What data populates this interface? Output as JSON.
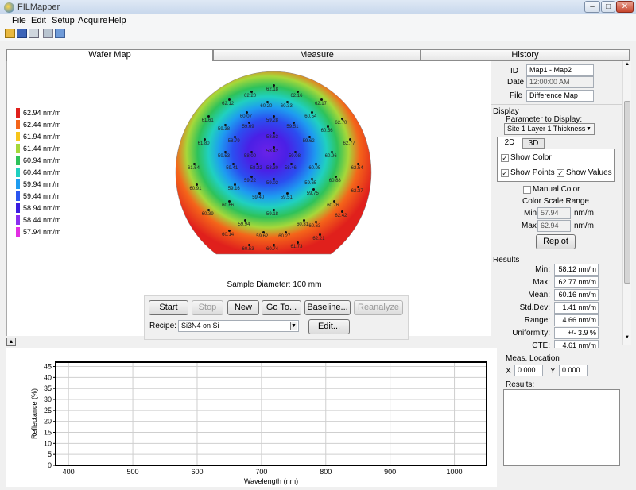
{
  "window": {
    "title": "FILMapper",
    "min": "–",
    "max": "□",
    "close": "✕"
  },
  "menu": [
    "File",
    "Edit",
    "Setup",
    "Acquire",
    "Help"
  ],
  "tabs": [
    "Wafer Map",
    "Measure",
    "History"
  ],
  "legend": [
    {
      "label": "62.94 nm/m",
      "color": "#e0201c"
    },
    {
      "label": "62.44 nm/m",
      "color": "#f4651a"
    },
    {
      "label": "61.94 nm/m",
      "color": "#f7c51b"
    },
    {
      "label": "61.44 nm/m",
      "color": "#a6d83a"
    },
    {
      "label": "60.94 nm/m",
      "color": "#2ec25a"
    },
    {
      "label": "60.44 nm/m",
      "color": "#20d0c0"
    },
    {
      "label": "59.94 nm/m",
      "color": "#1e9cf0"
    },
    {
      "label": "59.44 nm/m",
      "color": "#2b56f0"
    },
    {
      "label": "58.94 nm/m",
      "color": "#3b1ee0"
    },
    {
      "label": "58.44 nm/m",
      "color": "#8a2ef0"
    },
    {
      "label": "57.94 nm/m",
      "color": "#e22ee2"
    }
  ],
  "wafer": {
    "sample_diameter": "Sample Diameter: 100 mm",
    "points": [
      {
        "v": "62.18",
        "x": 0.5,
        "y": 0.1
      },
      {
        "v": "62.20",
        "x": 0.39,
        "y": 0.13
      },
      {
        "v": "62.16",
        "x": 0.62,
        "y": 0.13
      },
      {
        "v": "62.12",
        "x": 0.28,
        "y": 0.17
      },
      {
        "v": "60.20",
        "x": 0.47,
        "y": 0.18
      },
      {
        "v": "60.33",
        "x": 0.57,
        "y": 0.18
      },
      {
        "v": "62.17",
        "x": 0.74,
        "y": 0.17
      },
      {
        "v": "60.07",
        "x": 0.37,
        "y": 0.23
      },
      {
        "v": "60.54",
        "x": 0.69,
        "y": 0.23
      },
      {
        "v": "61.61",
        "x": 0.18,
        "y": 0.25
      },
      {
        "v": "62.70",
        "x": 0.84,
        "y": 0.26
      },
      {
        "v": "59.28",
        "x": 0.5,
        "y": 0.25
      },
      {
        "v": "59.38",
        "x": 0.26,
        "y": 0.29
      },
      {
        "v": "59.69",
        "x": 0.38,
        "y": 0.28
      },
      {
        "v": "59.51",
        "x": 0.6,
        "y": 0.28
      },
      {
        "v": "60.56",
        "x": 0.77,
        "y": 0.3
      },
      {
        "v": "58.63",
        "x": 0.5,
        "y": 0.33
      },
      {
        "v": "58.79",
        "x": 0.31,
        "y": 0.35
      },
      {
        "v": "59.62",
        "x": 0.68,
        "y": 0.35
      },
      {
        "v": "61.80",
        "x": 0.16,
        "y": 0.36
      },
      {
        "v": "62.77",
        "x": 0.88,
        "y": 0.36
      },
      {
        "v": "58.42",
        "x": 0.5,
        "y": 0.4
      },
      {
        "v": "59.53",
        "x": 0.26,
        "y": 0.42
      },
      {
        "v": "58.00",
        "x": 0.39,
        "y": 0.42
      },
      {
        "v": "59.08",
        "x": 0.61,
        "y": 0.42
      },
      {
        "v": "60.96",
        "x": 0.79,
        "y": 0.42
      },
      {
        "v": "61.54",
        "x": 0.11,
        "y": 0.48
      },
      {
        "v": "59.41",
        "x": 0.3,
        "y": 0.48
      },
      {
        "v": "58.22",
        "x": 0.42,
        "y": 0.48
      },
      {
        "v": "58.30",
        "x": 0.5,
        "y": 0.48
      },
      {
        "v": "58.46",
        "x": 0.59,
        "y": 0.48
      },
      {
        "v": "60.05",
        "x": 0.71,
        "y": 0.48
      },
      {
        "v": "62.54",
        "x": 0.92,
        "y": 0.48
      },
      {
        "v": "59.22",
        "x": 0.39,
        "y": 0.54
      },
      {
        "v": "59.02",
        "x": 0.5,
        "y": 0.55
      },
      {
        "v": "59.65",
        "x": 0.69,
        "y": 0.55
      },
      {
        "v": "60.88",
        "x": 0.81,
        "y": 0.54
      },
      {
        "v": "60.91",
        "x": 0.12,
        "y": 0.58
      },
      {
        "v": "59.16",
        "x": 0.31,
        "y": 0.58
      },
      {
        "v": "59.75",
        "x": 0.7,
        "y": 0.6
      },
      {
        "v": "62.37",
        "x": 0.92,
        "y": 0.59
      },
      {
        "v": "59.40",
        "x": 0.43,
        "y": 0.62
      },
      {
        "v": "59.51",
        "x": 0.57,
        "y": 0.62
      },
      {
        "v": "60.66",
        "x": 0.28,
        "y": 0.66
      },
      {
        "v": "60.76",
        "x": 0.8,
        "y": 0.66
      },
      {
        "v": "60.39",
        "x": 0.18,
        "y": 0.7
      },
      {
        "v": "59.18",
        "x": 0.5,
        "y": 0.7
      },
      {
        "v": "62.42",
        "x": 0.84,
        "y": 0.71
      },
      {
        "v": "59.94",
        "x": 0.36,
        "y": 0.75
      },
      {
        "v": "60.31",
        "x": 0.65,
        "y": 0.75
      },
      {
        "v": "60.63",
        "x": 0.71,
        "y": 0.76
      },
      {
        "v": "60.14",
        "x": 0.28,
        "y": 0.8
      },
      {
        "v": "59.62",
        "x": 0.45,
        "y": 0.81
      },
      {
        "v": "60.27",
        "x": 0.56,
        "y": 0.81
      },
      {
        "v": "62.21",
        "x": 0.73,
        "y": 0.82
      },
      {
        "v": "60.53",
        "x": 0.38,
        "y": 0.87
      },
      {
        "v": "60.74",
        "x": 0.5,
        "y": 0.87
      },
      {
        "v": "61.73",
        "x": 0.62,
        "y": 0.86
      }
    ]
  },
  "buttons": {
    "start": "Start",
    "stop": "Stop",
    "new": "New",
    "goto": "Go To...",
    "baseline": "Baseline...",
    "reanalyze": "Reanalyze",
    "edit": "Edit..."
  },
  "recipe": {
    "label": "Recipe:",
    "value": "Si3N4 on Si"
  },
  "info": {
    "id_label": "ID",
    "id_value": "Map1 - Map2",
    "date_label": "Date",
    "date_value": "12:00:00 AM",
    "file_label": "File",
    "file_value": "Difference Map"
  },
  "display": {
    "title": "Display",
    "param_label": "Parameter to Display:",
    "param_value": "Site 1 Layer 1 Thickness",
    "tab_2d": "2D",
    "tab_3d": "3D",
    "show_color": "Show Color",
    "show_points": "Show Points",
    "show_values": "Show Values",
    "manual_color": "Manual Color",
    "scale_title": "Color Scale Range",
    "min_label": "Min",
    "min_value": "57.94",
    "max_label": "Max",
    "max_value": "62.94",
    "unit": "nm/m",
    "replot": "Replot"
  },
  "results": {
    "title": "Results",
    "rows": [
      {
        "label": "Min:",
        "value": "58.12 nm/m"
      },
      {
        "label": "Max:",
        "value": "62.77 nm/m"
      },
      {
        "label": "Mean:",
        "value": "60.16 nm/m"
      },
      {
        "label": "Std.Dev:",
        "value": "1.41 nm/m"
      },
      {
        "label": "Range:",
        "value": "4.66 nm/m"
      },
      {
        "label": "Uniformity:",
        "value": "+/- 3.9 %"
      },
      {
        "label": "CTE:",
        "value": "4.61 nm/m"
      }
    ]
  },
  "bottom": {
    "meas_title": "Meas. Location",
    "x_label": "X",
    "x_value": "0.000",
    "y_label": "Y",
    "y_value": "0.000",
    "results_label": "Results:"
  },
  "chart_data": {
    "type": "line",
    "xlabel": "Wavelength (nm)",
    "ylabel": "Reflectance (%)",
    "xlim": [
      380,
      1050
    ],
    "ylim": [
      0,
      47
    ],
    "xticks": [
      400,
      500,
      600,
      700,
      800,
      900,
      1000
    ],
    "yticks": [
      0,
      5,
      10,
      15,
      20,
      25,
      30,
      35,
      40,
      45
    ],
    "grid": true,
    "series": []
  }
}
